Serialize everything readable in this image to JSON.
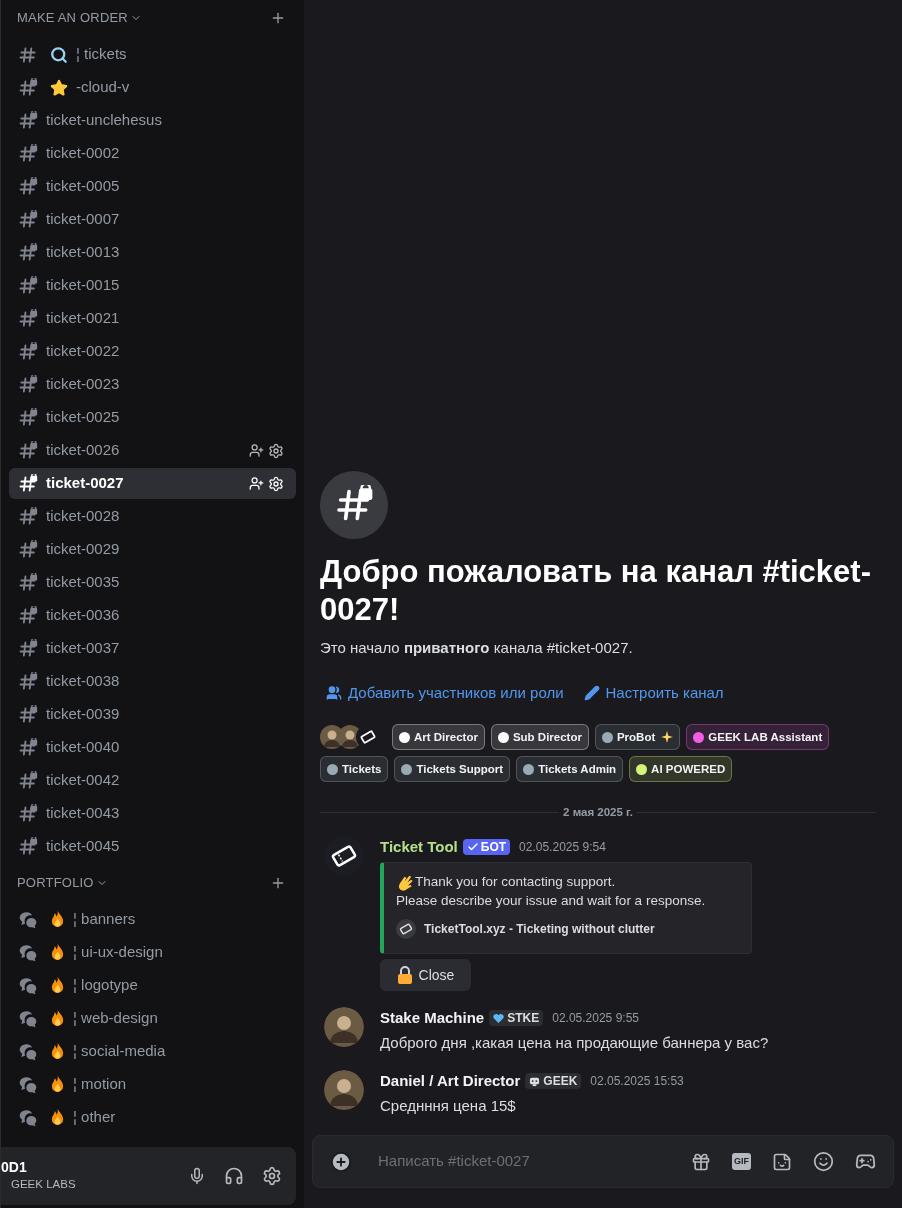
{
  "sidebar": {
    "categories": [
      {
        "name": "MAKE AN ORDER",
        "channels": [
          {
            "name": "¦ tickets",
            "kind": "text",
            "prefix": {
              "kind": "search"
            },
            "selected": false,
            "actions": false
          },
          {
            "name": "-cloud-v",
            "kind": "locked",
            "prefix": {
              "kind": "star"
            },
            "selected": false,
            "actions": false
          },
          {
            "name": "ticket-unclehesus",
            "kind": "locked",
            "selected": false,
            "actions": false
          },
          {
            "name": "ticket-0002",
            "kind": "locked",
            "selected": false,
            "actions": false
          },
          {
            "name": "ticket-0005",
            "kind": "locked",
            "selected": false,
            "actions": false
          },
          {
            "name": "ticket-0007",
            "kind": "locked",
            "selected": false,
            "actions": false
          },
          {
            "name": "ticket-0013",
            "kind": "locked",
            "selected": false,
            "actions": false
          },
          {
            "name": "ticket-0015",
            "kind": "locked",
            "selected": false,
            "actions": false
          },
          {
            "name": "ticket-0021",
            "kind": "locked",
            "selected": false,
            "actions": false
          },
          {
            "name": "ticket-0022",
            "kind": "locked",
            "selected": false,
            "actions": false
          },
          {
            "name": "ticket-0023",
            "kind": "locked",
            "selected": false,
            "actions": false
          },
          {
            "name": "ticket-0025",
            "kind": "locked",
            "selected": false,
            "actions": false
          },
          {
            "name": "ticket-0026",
            "kind": "locked",
            "selected": false,
            "actions": true
          },
          {
            "name": "ticket-0027",
            "kind": "locked",
            "selected": true,
            "actions": true
          },
          {
            "name": "ticket-0028",
            "kind": "locked",
            "selected": false,
            "actions": false
          },
          {
            "name": "ticket-0029",
            "kind": "locked",
            "selected": false,
            "actions": false
          },
          {
            "name": "ticket-0035",
            "kind": "locked",
            "selected": false,
            "actions": false
          },
          {
            "name": "ticket-0036",
            "kind": "locked",
            "selected": false,
            "actions": false
          },
          {
            "name": "ticket-0037",
            "kind": "locked",
            "selected": false,
            "actions": false
          },
          {
            "name": "ticket-0038",
            "kind": "locked",
            "selected": false,
            "actions": false
          },
          {
            "name": "ticket-0039",
            "kind": "locked",
            "selected": false,
            "actions": false
          },
          {
            "name": "ticket-0040",
            "kind": "locked",
            "selected": false,
            "actions": false
          },
          {
            "name": "ticket-0042",
            "kind": "locked",
            "selected": false,
            "actions": false
          },
          {
            "name": "ticket-0043",
            "kind": "locked",
            "selected": false,
            "actions": false
          },
          {
            "name": "ticket-0045",
            "kind": "locked",
            "selected": false,
            "actions": false
          }
        ]
      },
      {
        "name": "PORTFOLIO",
        "channels": [
          {
            "name": "¦ banners",
            "kind": "forum",
            "prefix": {
              "kind": "fire"
            },
            "selected": false,
            "actions": false
          },
          {
            "name": "¦ ui-ux-design",
            "kind": "forum",
            "prefix": {
              "kind": "fire"
            },
            "selected": false,
            "actions": false
          },
          {
            "name": "¦ logotype",
            "kind": "forum",
            "prefix": {
              "kind": "fire"
            },
            "selected": false,
            "actions": false
          },
          {
            "name": "¦ web-design",
            "kind": "forum",
            "prefix": {
              "kind": "fire"
            },
            "selected": false,
            "actions": false
          },
          {
            "name": "¦ social-media",
            "kind": "forum",
            "prefix": {
              "kind": "fire"
            },
            "selected": false,
            "actions": false
          },
          {
            "name": "¦ motion",
            "kind": "forum",
            "prefix": {
              "kind": "fire"
            },
            "selected": false,
            "actions": false
          },
          {
            "name": "¦ other",
            "kind": "forum",
            "prefix": {
              "kind": "fire"
            },
            "selected": false,
            "actions": false
          }
        ]
      }
    ]
  },
  "user_panel": {
    "name": "0D1",
    "status": "GEEK LABS"
  },
  "welcome": {
    "title": "Добро пожаловать на канал #ticket-0027!",
    "text": "Это начало **приватного** канала #ticket-0027.",
    "actions": [
      {
        "label": "Добавить участников или роли",
        "kind": "add"
      },
      {
        "label": "Настроить канал",
        "kind": "edit"
      }
    ],
    "members": [
      {
        "kind": "avatar"
      },
      {
        "kind": "avatar"
      },
      {
        "kind": "bot"
      }
    ],
    "roles": [
      {
        "name": "Art Director",
        "color": "#ffffff",
        "kind": "plain"
      },
      {
        "name": "Sub Director",
        "color": "#ffffff",
        "kind": "plain"
      },
      {
        "name": "ProBot",
        "color": "#99aab5",
        "kind": "sparkle"
      },
      {
        "name": "GEEK LAB Assistant",
        "color": "#f35ce4",
        "kind": "plain"
      },
      {
        "name": "Tickets",
        "color": "#99aab5",
        "kind": "plain"
      },
      {
        "name": "Tickets Support",
        "color": "#99aab5",
        "kind": "plain"
      },
      {
        "name": "Tickets Admin",
        "color": "#99aab5",
        "kind": "plain"
      },
      {
        "name": "AI POWERED",
        "color": "#d4f57a",
        "kind": "plain"
      }
    ]
  },
  "date_divider": "2 мая 2025 г.",
  "messages": [
    {
      "kind": "bot",
      "author": "Ticket Tool",
      "color": "#b5e08a",
      "badge": {
        "label": "БОТ",
        "kind": "bot"
      },
      "time": "02.05.2025 9:54",
      "embed": {
        "lines": [
          "Thank you for contacting support.",
          "Please describe your issue and wait for a response."
        ],
        "footer": "TicketTool.xyz - Ticketing without clutter"
      },
      "button": {
        "label": "Close"
      }
    },
    {
      "kind": "user",
      "author": "Stake Machine",
      "color": "#f2f3f5",
      "badge": {
        "label": "STKE",
        "kind": "heart"
      },
      "time": "02.05.2025 9:55",
      "text": "Доброго дня ,какая цена на продающие баннера у вас?"
    },
    {
      "kind": "user",
      "author": "Daniel / Art  Director",
      "color": "#f2f3f5",
      "badge": {
        "label": "GEEK",
        "kind": "geek"
      },
      "time": "02.05.2025 15:53",
      "text": "Среднння цена 15$"
    }
  ],
  "composer": {
    "placeholder": "Написать #ticket-0027",
    "gif_label": "GIF"
  }
}
